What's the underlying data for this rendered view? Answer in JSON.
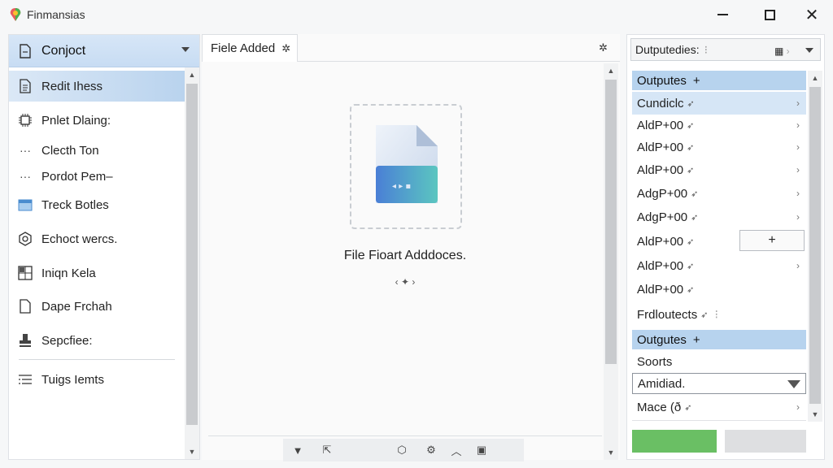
{
  "window": {
    "title": "Finmansias",
    "minimize_icon": "minimize-icon",
    "maximize_icon": "maximize-icon",
    "close_icon": "close-icon"
  },
  "sidebar": {
    "project": {
      "label": "Conjoct",
      "icon": "document-icon"
    },
    "items": [
      {
        "label": "Redit Ihess",
        "icon": "document-lines-icon",
        "active": true
      },
      {
        "label": "Pnlet Dlaing:",
        "icon": "chip-icon"
      },
      {
        "label": "Clecth Ton",
        "icon": "ellipsis-icon"
      },
      {
        "label": "Pordot Pem–",
        "icon": "ellipsis-icon"
      },
      {
        "label": "Treck Botles",
        "icon": "calendar-icon"
      },
      {
        "label": "Echoct wercs.",
        "icon": "settings-icon"
      },
      {
        "label": "Iniqn Kela",
        "icon": "grid-icon"
      },
      {
        "label": "Dape Frchah",
        "icon": "page-icon"
      },
      {
        "label": "Sepcfiee:",
        "icon": "stamp-icon"
      },
      {
        "label": "Tuigs Iemts",
        "icon": "list-icon"
      }
    ]
  },
  "center": {
    "tab_label": "Fiele Added",
    "drop_title": "File Fioart Adddoces.",
    "drop_sub": "‹ ✦ ›"
  },
  "right": {
    "selector_label": "Dutputedies:",
    "section1": {
      "label": "Outputes",
      "plus": "+"
    },
    "rows": [
      {
        "label": "Cundiclc",
        "selected": true,
        "chevron": true
      },
      {
        "label": "AldP+00",
        "chevron": true
      },
      {
        "label": "AldP+00",
        "chevron": true
      },
      {
        "label": "AldP+00",
        "chevron": true
      },
      {
        "label": "AdgP+00",
        "chevron": true
      },
      {
        "label": "AdgP+00",
        "chevron": true
      },
      {
        "label": "AldP+00",
        "chevron": false
      },
      {
        "label": "AldP+00",
        "chevron": true
      },
      {
        "label": "AldP+00",
        "chevron": false
      },
      {
        "label": "Frdloutects",
        "chevron": false
      }
    ],
    "add_label": "+",
    "section2": {
      "label": "Outgutes",
      "plus": "+"
    },
    "sorts_label": "Soorts",
    "dropdown_value": "Amidiad.",
    "mace_label": "Mace (ð",
    "accent_green": "#6abf64"
  }
}
